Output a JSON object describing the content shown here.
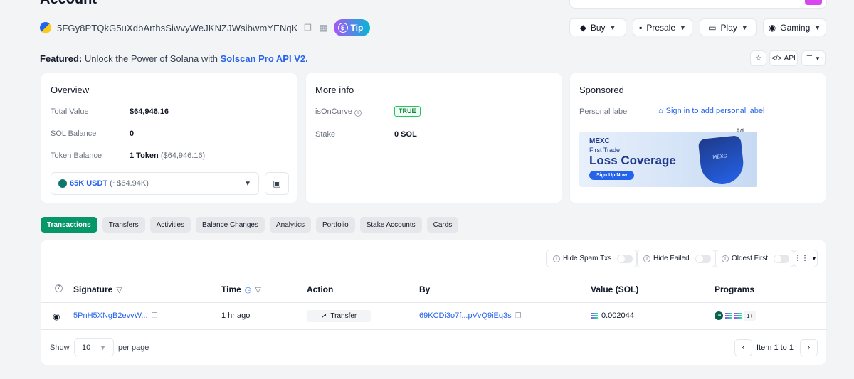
{
  "header": {
    "title": "Account",
    "address": "5FGy8PTQkG5uXdbArthsSiwvyWeJKNZJWsibwmYENqK",
    "tip_label": "Tip",
    "nav": [
      {
        "label": "Buy",
        "icon": "tag-icon"
      },
      {
        "label": "Presale",
        "icon": "grid-icon"
      },
      {
        "label": "Play",
        "icon": "screen-icon"
      },
      {
        "label": "Gaming",
        "icon": "gamepad-icon"
      }
    ]
  },
  "featured": {
    "prefix": "Featured:",
    "text": "Unlock the Power of Solana with",
    "link": "Solscan Pro API V2."
  },
  "utils": {
    "api_label": "API"
  },
  "overview": {
    "title": "Overview",
    "total_value_label": "Total Value",
    "total_value": "$64,946.16",
    "sol_balance_label": "SOL Balance",
    "sol_balance": "0",
    "token_balance_label": "Token Balance",
    "token_balance": "1 Token",
    "token_balance_usd": "($64,946.16)",
    "token_select_amount": "65K USDT",
    "token_select_usd": "(~$64.94K)"
  },
  "more_info": {
    "title": "More info",
    "is_on_curve_label": "isOnCurve",
    "is_on_curve_value": "TRUE",
    "stake_label": "Stake",
    "stake_value": "0 SOL"
  },
  "sponsored": {
    "title": "Sponsored",
    "personal_label": "Personal label",
    "sign_in_link": "Sign in to add personal label",
    "ad_tag": "Ad",
    "ad_brand": "MEXC",
    "ad_line1": "First Trade",
    "ad_line2": "Loss Coverage",
    "ad_cta": "Sign Up Now",
    "ad_shield_text": "MEXC"
  },
  "tabs": [
    "Transactions",
    "Transfers",
    "Activities",
    "Balance Changes",
    "Analytics",
    "Portfolio",
    "Stake Accounts",
    "Cards"
  ],
  "filters": {
    "hide_spam": "Hide Spam Txs",
    "hide_failed": "Hide Failed",
    "oldest_first": "Oldest First"
  },
  "table": {
    "headers": {
      "signature": "Signature",
      "time": "Time",
      "action": "Action",
      "by": "By",
      "value": "Value (SOL)",
      "programs": "Programs"
    },
    "rows": [
      {
        "signature": "5PnH5XNgB2evvW...",
        "time": "1 hr ago",
        "action": "Transfer",
        "by": "69KCDi3o7f...pVvQ9iEq3s",
        "value": "0.002044",
        "programs_more": "1+"
      }
    ]
  },
  "pagination": {
    "show_label": "Show",
    "page_size": "10",
    "per_page_label": "per page",
    "info": "Item 1 to 1"
  }
}
